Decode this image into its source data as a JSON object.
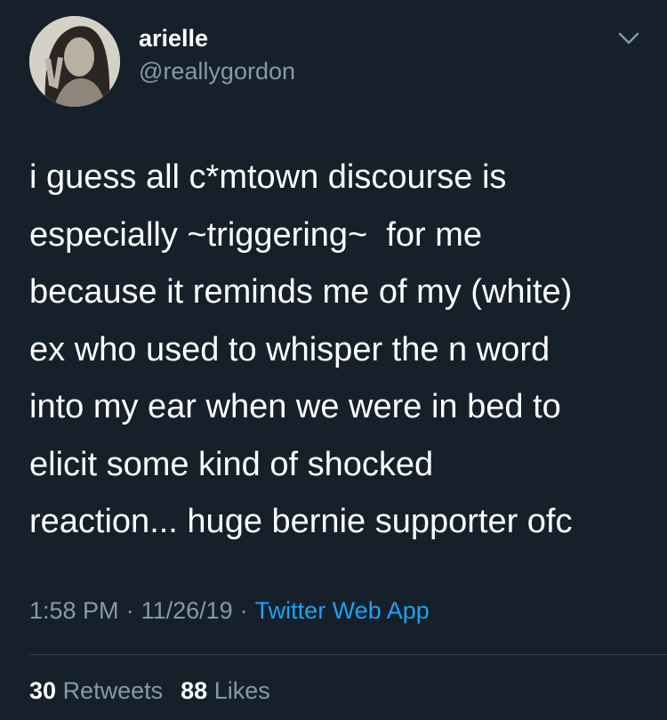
{
  "user": {
    "name": "arielle",
    "handle": "@reallygordon"
  },
  "tweet": {
    "lines": [
      "i guess all c*mtown discourse is",
      "especially ~triggering~  for me",
      "because it reminds me of my (white)",
      "ex who used to whisper the n word",
      "into my ear when we were in bed to",
      "elicit some kind of shocked",
      "reaction... huge bernie supporter ofc"
    ],
    "time": "1:58 PM",
    "date": "11/26/19",
    "source": "Twitter Web App"
  },
  "stats": {
    "retweets_count": "30",
    "retweets_label": "Retweets",
    "likes_count": "88",
    "likes_label": "Likes"
  },
  "icons": {
    "avatar": "profile-photo",
    "chevron": "chevron-down-icon"
  },
  "colors": {
    "background": "#15202b",
    "secondary_text": "#8899a6",
    "link": "#1da1f2"
  }
}
